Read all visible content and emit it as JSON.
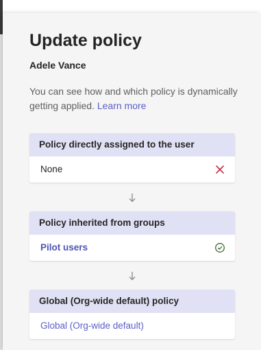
{
  "page": {
    "title": "Update policy",
    "user_name": "Adele Vance",
    "description": "You can see how and which policy is dynamically getting applied.",
    "learn_more_label": "Learn more"
  },
  "cards": [
    {
      "header": "Policy directly assigned to the user",
      "value": "None",
      "status_icon": "close-icon",
      "status_color": "#c4314b"
    },
    {
      "header": "Policy inherited from groups",
      "value": "Pilot users",
      "status_icon": "check-circle-icon",
      "status_color": "#3b6e2b"
    },
    {
      "header": "Global (Org-wide default) policy",
      "value": "Global (Org-wide default)"
    }
  ],
  "colors": {
    "accent": "#5b5fc7",
    "header_bg": "#e1e1f5",
    "panel_bg": "#f5f5f5"
  }
}
